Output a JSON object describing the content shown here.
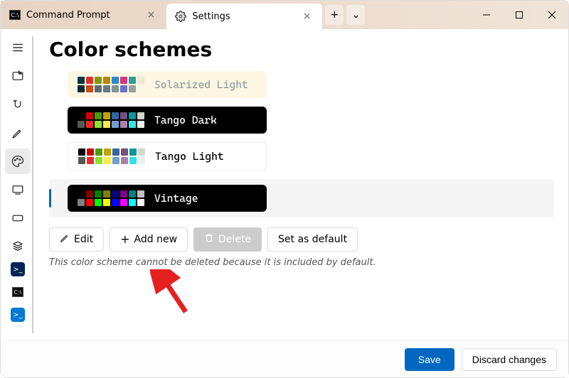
{
  "tabs": [
    {
      "label": "Command Prompt",
      "icon": "cmd"
    },
    {
      "label": "Settings",
      "icon": "gear"
    }
  ],
  "tab_actions": {
    "new": "+",
    "dropdown": "⌄"
  },
  "page_title": "Color schemes",
  "schemes": [
    {
      "name": "Solarized Light",
      "theme": "light",
      "colors": [
        "#073642",
        "#dc322f",
        "#859900",
        "#b58900",
        "#268bd2",
        "#d33682",
        "#2aa198",
        "#eee8d5",
        "#002b36",
        "#cb4b16",
        "#586e75",
        "#657b83",
        "#839496",
        "#6c71c4",
        "#93a1a1",
        "#fdf6e3"
      ]
    },
    {
      "name": "Tango Dark",
      "theme": "dark",
      "colors": [
        "#000000",
        "#cc0000",
        "#4e9a06",
        "#c4a000",
        "#3465a4",
        "#75507b",
        "#06989a",
        "#d3d7cf",
        "#555753",
        "#ef2929",
        "#8ae234",
        "#fce94f",
        "#729fcf",
        "#ad7fa8",
        "#34e2e2",
        "#eeeeec"
      ]
    },
    {
      "name": "Tango Light",
      "theme": "white",
      "colors": [
        "#000000",
        "#cc0000",
        "#4e9a06",
        "#c4a000",
        "#3465a4",
        "#75507b",
        "#06989a",
        "#d3d7cf",
        "#555753",
        "#ef2929",
        "#8ae234",
        "#fce94f",
        "#729fcf",
        "#ad7fa8",
        "#34e2e2",
        "#eeeeec"
      ]
    },
    {
      "name": "Vintage",
      "theme": "dark",
      "selected": true,
      "colors": [
        "#000000",
        "#800000",
        "#008000",
        "#808000",
        "#000080",
        "#800080",
        "#008080",
        "#c0c0c0",
        "#808080",
        "#ff0000",
        "#00ff00",
        "#ffff00",
        "#0000ff",
        "#ff00ff",
        "#00ffff",
        "#ffffff"
      ]
    }
  ],
  "actions": {
    "edit": "Edit",
    "add": "Add new",
    "delete": "Delete",
    "default": "Set as default"
  },
  "hint_text": "This color scheme cannot be deleted because it is included by default.",
  "footer": {
    "save": "Save",
    "discard": "Discard changes"
  }
}
